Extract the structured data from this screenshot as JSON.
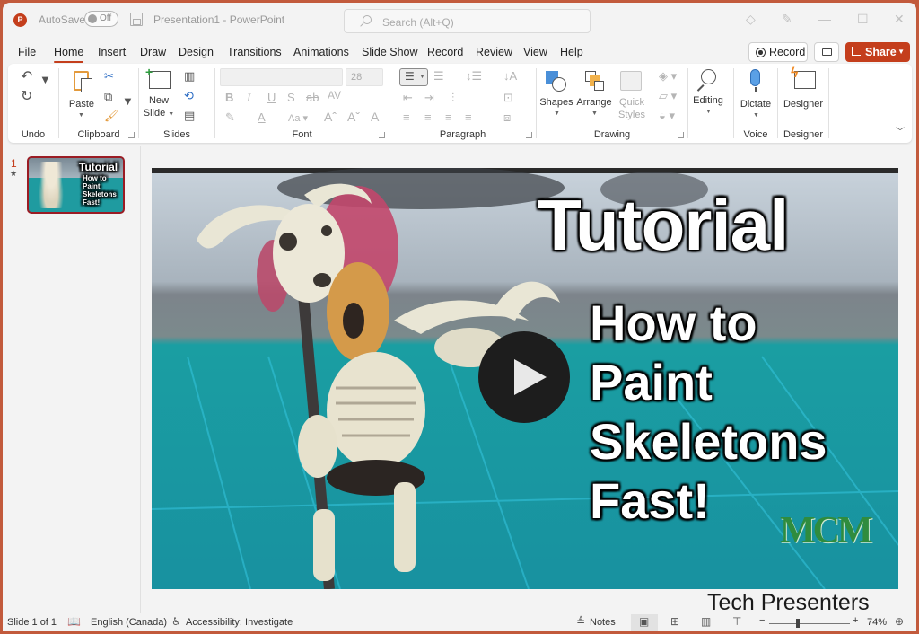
{
  "titlebar": {
    "app_logo": "P",
    "autosave_label": "AutoSave",
    "autosave_state": "Off",
    "doc_title": "Presentation1  -  PowerPoint",
    "search_placeholder": "Search (Alt+Q)",
    "icons": [
      "diamond-icon",
      "pen-icon",
      "minimize-icon",
      "maximize-icon",
      "close-icon"
    ]
  },
  "tabs": [
    {
      "label": "File"
    },
    {
      "label": "Home",
      "active": true
    },
    {
      "label": "Insert"
    },
    {
      "label": "Draw"
    },
    {
      "label": "Design"
    },
    {
      "label": "Transitions"
    },
    {
      "label": "Animations"
    },
    {
      "label": "Slide Show"
    },
    {
      "label": "Record"
    },
    {
      "label": "Review"
    },
    {
      "label": "View"
    },
    {
      "label": "Help"
    }
  ],
  "header_buttons": {
    "record": "Record",
    "share": "Share"
  },
  "ribbon": {
    "groups": {
      "undo": "Undo",
      "clipboard": "Clipboard",
      "slides": "Slides",
      "font": "Font",
      "paragraph": "Paragraph",
      "drawing": "Drawing",
      "voice": "Voice",
      "designer": "Designer"
    },
    "buttons": {
      "paste": "Paste",
      "new_slide_1": "New",
      "new_slide_2": "Slide",
      "shapes": "Shapes",
      "arrange": "Arrange",
      "quick_styles_1": "Quick",
      "quick_styles_2": "Styles",
      "editing": "Editing",
      "dictate": "Dictate",
      "designer": "Designer"
    },
    "font_name": "",
    "font_size": "28",
    "font_buttons": [
      "B",
      "I",
      "U",
      "S",
      "ab",
      "AV"
    ]
  },
  "thumbnails": [
    {
      "number": "1",
      "title": "Tutorial",
      "lines": [
        "How to",
        "Paint",
        "Skeletons",
        "Fast!"
      ]
    }
  ],
  "slide": {
    "title": "Tutorial",
    "subtitle_lines": [
      "How to",
      "Paint",
      "Skeletons",
      "Fast!"
    ],
    "logo_text": "MCM",
    "footer": "Tech Presenters",
    "media": "video-thumbnail"
  },
  "statusbar": {
    "slide_info": "Slide 1 of 1",
    "language": "English (Canada)",
    "accessibility": "Accessibility: Investigate",
    "notes": "Notes",
    "zoom_percent": "74%",
    "zoom_level": 0.74
  }
}
